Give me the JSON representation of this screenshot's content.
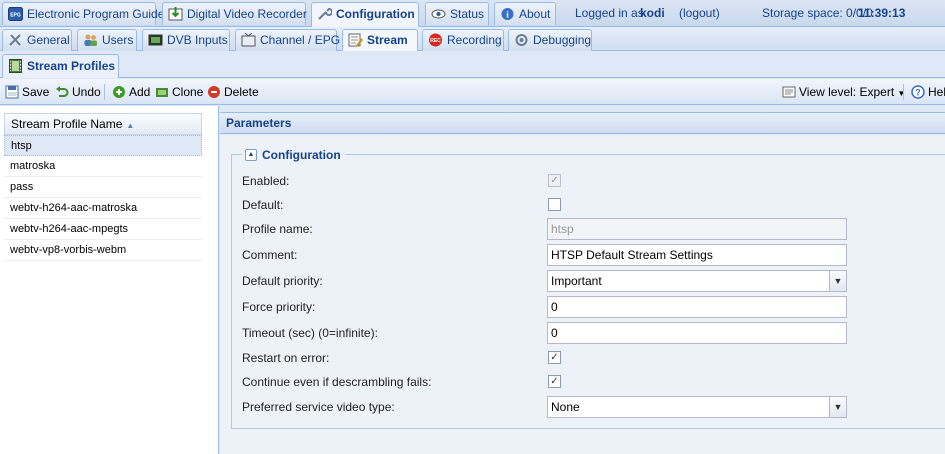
{
  "top_tabs": [
    {
      "label": "Electronic Program Guide",
      "icon": "epg-icon"
    },
    {
      "label": "Digital Video Recorder",
      "icon": "dvr-icon"
    },
    {
      "label": "Configuration",
      "icon": "wrench-icon",
      "active": true
    },
    {
      "label": "Status",
      "icon": "eye-icon"
    },
    {
      "label": "About",
      "icon": "info-icon"
    }
  ],
  "status": {
    "logged_in_prefix": "Logged in as",
    "user": "kodi",
    "logout": "(logout)",
    "storage": "Storage space: 0/0/0",
    "time": "11:39:13"
  },
  "config_tabs": [
    {
      "label": "General",
      "icon": "tools-icon"
    },
    {
      "label": "Users",
      "icon": "users-icon"
    },
    {
      "label": "DVB Inputs",
      "icon": "dvb-icon"
    },
    {
      "label": "Channel / EPG",
      "icon": "tv-icon"
    },
    {
      "label": "Stream",
      "icon": "stream-icon",
      "active": true
    },
    {
      "label": "Recording",
      "icon": "rec-icon"
    },
    {
      "label": "Debugging",
      "icon": "debug-icon"
    }
  ],
  "stream_tabs": [
    {
      "label": "Stream Profiles",
      "icon": "film-icon"
    }
  ],
  "toolbar": {
    "save": "Save",
    "undo": "Undo",
    "add": "Add",
    "clone": "Clone",
    "delete": "Delete",
    "view_level": "View level: Expert",
    "help": "Help"
  },
  "grid": {
    "column": "Stream Profile Name",
    "rows": [
      "htsp",
      "matroska",
      "pass",
      "webtv-h264-aac-matroska",
      "webtv-h264-aac-mpegts",
      "webtv-vp8-vorbis-webm"
    ],
    "selected_index": 0
  },
  "params": {
    "title": "Parameters",
    "section": "Configuration",
    "fields": {
      "enabled": {
        "label": "Enabled:",
        "checked": true,
        "disabled": true
      },
      "default": {
        "label": "Default:",
        "checked": false
      },
      "profile_name": {
        "label": "Profile name:",
        "value": "htsp",
        "disabled": true
      },
      "comment": {
        "label": "Comment:",
        "value": "HTSP Default Stream Settings"
      },
      "default_priority": {
        "label": "Default priority:",
        "value": "Important"
      },
      "force_priority": {
        "label": "Force priority:",
        "value": "0"
      },
      "timeout": {
        "label": "Timeout (sec) (0=infinite):",
        "value": "0"
      },
      "restart_on_error": {
        "label": "Restart on error:",
        "checked": true
      },
      "continue_descrambling": {
        "label": "Continue even if descrambling fails:",
        "checked": true
      },
      "preferred_video_type": {
        "label": "Preferred service video type:",
        "value": "None"
      }
    }
  },
  "colors": {
    "panel_bg": "#dfe8f6",
    "header_text": "#15428b",
    "border": "#99bbe8"
  }
}
